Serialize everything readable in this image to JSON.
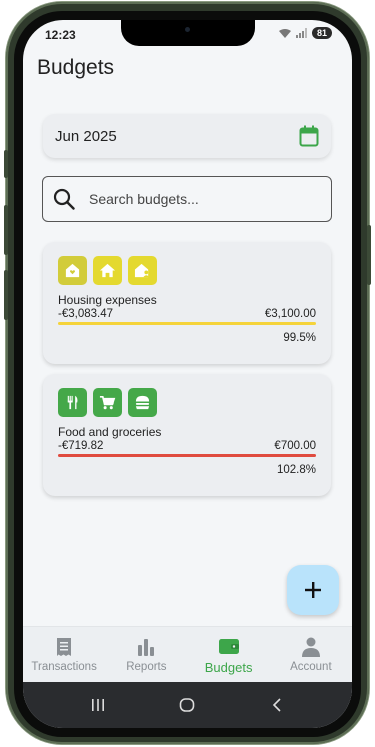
{
  "status_bar": {
    "time": "12:23",
    "battery": "81"
  },
  "page": {
    "title": "Budgets"
  },
  "month_picker": {
    "label": "Jun 2025",
    "icon": "calendar-icon"
  },
  "search": {
    "placeholder": "Search budgets..."
  },
  "budgets": [
    {
      "name": "Housing expenses",
      "spent": "-€3,083.47",
      "limit": "€3,100.00",
      "percent": "99.5%",
      "progress_value": 0.995,
      "bar_color": "#f5d33a",
      "icon_colors": [
        "#d2cc3a",
        "#e4d92f",
        "#e4d92f"
      ],
      "icons": [
        "house-heart-icon",
        "home-icon",
        "house-user-icon"
      ]
    },
    {
      "name": "Food and groceries",
      "spent": "-€719.82",
      "limit": "€700.00",
      "percent": "102.8%",
      "progress_value": 1.028,
      "bar_color": "#e04b3f",
      "icon_colors": [
        "#45a849",
        "#45a849",
        "#45a849"
      ],
      "icons": [
        "fork-knife-icon",
        "shopping-cart-icon",
        "burger-icon"
      ]
    }
  ],
  "bottom_nav": {
    "items": [
      {
        "label": "Transactions",
        "icon": "receipt-icon"
      },
      {
        "label": "Reports",
        "icon": "bar-chart-icon"
      },
      {
        "label": "Budgets",
        "icon": "wallet-icon",
        "active": true
      },
      {
        "label": "Account",
        "icon": "person-icon"
      }
    ]
  },
  "colors": {
    "accent": "#3da64a",
    "fab": "#b9e3fb",
    "background": "#f4f6f8"
  }
}
